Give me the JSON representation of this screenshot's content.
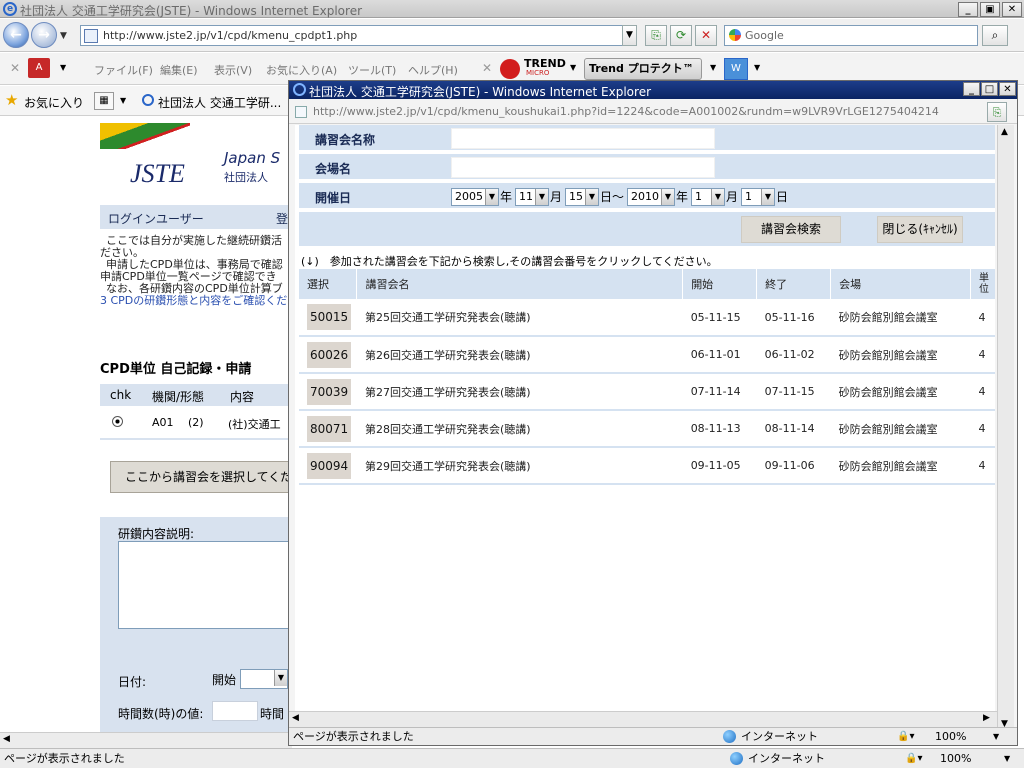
{
  "main_window": {
    "title": "社団法人 交通工学研究会(JSTE) - Windows Internet Explorer",
    "address": "http://www.jste2.jp/v1/cpd/kmenu_cpdpt1.php",
    "search_placeholder": "Google",
    "menu": [
      "ファイル(F)",
      "編集(E)",
      "表示(V)",
      "お気に入り(A)",
      "ツール(T)",
      "ヘルプ(H)"
    ],
    "trend_label": "TREND",
    "trend_sub": "MICRO",
    "trend_protect": "Trend プロテクト™",
    "favorites_label": "お気に入り",
    "tab_label": "社団法人 交通工学研...",
    "status_text": "ページが表示されました",
    "zone": "インターネット",
    "zoom": "100%"
  },
  "bg_page": {
    "logo": "JSTE",
    "org_en": "Japan S",
    "org_jp": "社団法人",
    "login_label": "ログインユーザー",
    "login_extra": "登",
    "para": [
      "ここでは自分が実施した継続研鑽活",
      "ださい。",
      "申請したCPD単位は、事務局で確認",
      "申請CPD単位一覧ページで確認でき",
      "なお、各研鑽内容のCPD単位計算ブ",
      "3 CPDの研鑽形態と内容をご確認くだ"
    ],
    "cpd_heading": "CPD単位 自己記録・申請",
    "cpd_cols": [
      "chk",
      "機関/形態",
      "内容"
    ],
    "cpd_row": [
      "A01",
      "(2)",
      "(社)交通工"
    ],
    "select_button": "ここから講習会を選択してくだ",
    "desc_label": "研鑽内容説明:",
    "date_label": "日付:",
    "start_label": "開始",
    "hours_label": "時間数(時)の値:",
    "hours_unit": "時間"
  },
  "popup": {
    "title": "社団法人 交通工学研究会(JSTE) - Windows Internet Explorer",
    "address": "http://www.jste2.jp/v1/cpd/kmenu_koushukai1.php?id=1224&code=A001002&rundm=w9LVR9VrLGE1275404214",
    "form": {
      "course_name_label": "講習会名称",
      "venue_label": "会場名",
      "date_label": "開催日",
      "from_year": "2005",
      "from_month": "11",
      "from_day": "15",
      "to_year": "2010",
      "to_month": "1",
      "to_day": "1",
      "year_unit": "年",
      "month_unit": "月",
      "day_unit": "日",
      "range_sep": "日～",
      "search_button": "講習会検索",
      "close_button": "閉じる(ｷｬﾝｾﾙ)"
    },
    "instruction": "(↓)　参加された講習会を下記から検索し,その講習会番号をクリックしてください。",
    "table": {
      "headers": [
        "選択",
        "講習会名",
        "開始",
        "終了",
        "会場",
        "単位"
      ],
      "rows": [
        {
          "id": "50015",
          "name": "第25回交通工学研究発表会(聴講)",
          "start": "05-11-15",
          "end": "05-11-16",
          "venue": "砂防会館別館会議室",
          "unit": "4"
        },
        {
          "id": "60026",
          "name": "第26回交通工学研究発表会(聴講)",
          "start": "06-11-01",
          "end": "06-11-02",
          "venue": "砂防会館別館会議室",
          "unit": "4"
        },
        {
          "id": "70039",
          "name": "第27回交通工学研究発表会(聴講)",
          "start": "07-11-14",
          "end": "07-11-15",
          "venue": "砂防会館別館会議室",
          "unit": "4"
        },
        {
          "id": "80071",
          "name": "第28回交通工学研究発表会(聴講)",
          "start": "08-11-13",
          "end": "08-11-14",
          "venue": "砂防会館別館会議室",
          "unit": "4"
        },
        {
          "id": "90094",
          "name": "第29回交通工学研究発表会(聴講)",
          "start": "09-11-05",
          "end": "09-11-06",
          "venue": "砂防会館別館会議室",
          "unit": "4"
        }
      ]
    },
    "status_text": "ページが表示されました",
    "zone": "インターネット",
    "zoom": "100%"
  }
}
